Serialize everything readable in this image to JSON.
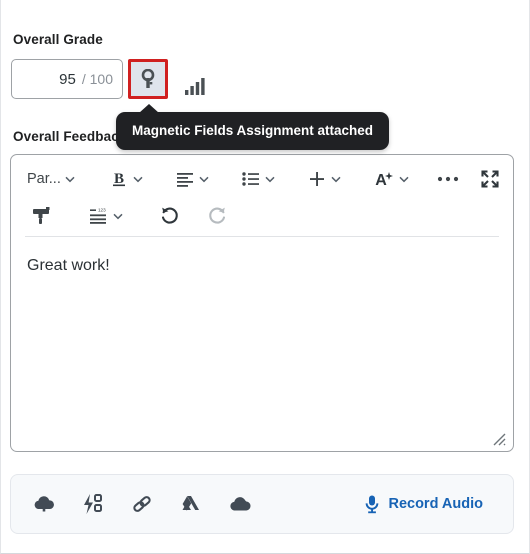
{
  "grade": {
    "label": "Overall Grade",
    "value": "95",
    "denominator": "/ 100",
    "attachment_button_icon": "key-icon",
    "statistics_button_icon": "bar-chart-icon",
    "focus_ring_color": "#d02020"
  },
  "tooltip": {
    "text": "Magnetic Fields Assignment attached",
    "background": "#202124",
    "text_color": "#ffffff"
  },
  "feedback": {
    "label": "Overall Feedback",
    "body_text": "Great work!"
  },
  "toolbar": {
    "row1": [
      {
        "name": "paragraph-format-dropdown",
        "label": "Par...",
        "icon": "text-style",
        "has_caret": true
      },
      {
        "name": "bold-button",
        "label": "B",
        "icon": "bold-icon",
        "has_caret": true
      },
      {
        "name": "align-button",
        "label": "",
        "icon": "align-left-icon",
        "has_caret": true
      },
      {
        "name": "list-button",
        "label": "",
        "icon": "bulleted-list-icon",
        "has_caret": true
      },
      {
        "name": "insert-button",
        "label": "",
        "icon": "plus-icon",
        "has_caret": true
      },
      {
        "name": "accessibility-check-button",
        "label": "",
        "icon": "font-sparkle-icon",
        "has_caret": true
      },
      {
        "name": "more-options-button",
        "label": "",
        "icon": "ellipsis-icon",
        "has_caret": false
      },
      {
        "name": "fullscreen-button",
        "label": "",
        "icon": "expand-icon",
        "has_caret": false
      }
    ],
    "row2": [
      {
        "name": "format-painter-button",
        "label": "",
        "icon": "format-painter-icon",
        "has_caret": false
      },
      {
        "name": "line-numbering-button",
        "label": "",
        "icon": "line-numbering-icon",
        "has_caret": true
      },
      {
        "name": "undo-button",
        "label": "",
        "icon": "undo-icon",
        "has_caret": false,
        "enabled": true
      },
      {
        "name": "redo-button",
        "label": "",
        "icon": "redo-icon",
        "has_caret": false,
        "enabled": false
      }
    ]
  },
  "attach_bar": {
    "icons": [
      {
        "name": "upload-cloud-icon",
        "title": "Insert Stuff"
      },
      {
        "name": "quicklink-icon",
        "title": "Quicklink"
      },
      {
        "name": "link-icon",
        "title": "Insert Link"
      },
      {
        "name": "google-drive-icon",
        "title": "Google Drive"
      },
      {
        "name": "onedrive-icon",
        "title": "OneDrive"
      }
    ],
    "record_audio_label": "Record Audio",
    "record_audio_color": "#1763b5"
  }
}
